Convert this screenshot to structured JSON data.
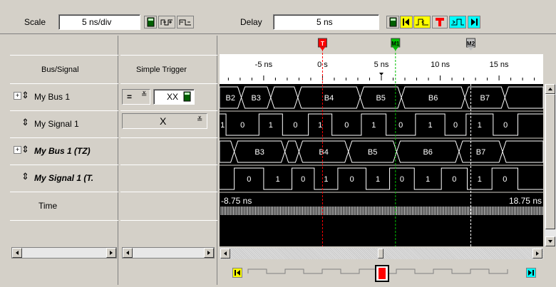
{
  "toolbar": {
    "scale_label": "Scale",
    "scale_value": "5 ns/div",
    "delay_label": "Delay",
    "delay_value": "5 ns"
  },
  "columns": {
    "bus_signal_header": "Bus/Signal",
    "trigger_header": "Simple Trigger"
  },
  "rows": [
    {
      "name": "My Bus 1",
      "type": "bus",
      "trigger_op": "=",
      "trigger_value": "XX"
    },
    {
      "name": "My Signal 1",
      "type": "signal",
      "trigger_value": "X"
    },
    {
      "name": "My Bus 1 (TZ)",
      "type": "bus"
    },
    {
      "name": "My Signal 1 (T.",
      "type": "signal"
    },
    {
      "name": "Time",
      "type": "time"
    }
  ],
  "markers": {
    "trigger": "T",
    "m1": "M1",
    "m2": "M2"
  },
  "ruler": {
    "ticks": [
      {
        "t": -5,
        "label": "-5 ns"
      },
      {
        "t": 0,
        "label": "0 s"
      },
      {
        "t": 5,
        "label": "5 ns"
      },
      {
        "t": 10,
        "label": "10 ns"
      },
      {
        "t": 15,
        "label": "15 ns"
      }
    ]
  },
  "time_row": {
    "start": "-8.75 ns",
    "end": "18.75 ns"
  },
  "waveform": {
    "t_start": -8.75,
    "t_end": 18.75,
    "trigger_time": 0,
    "m1_time": 6.2,
    "m2_time": 12.6,
    "bus1": {
      "segments": [
        {
          "t0": -8.75,
          "t1": -6.9,
          "label": "B2"
        },
        {
          "t0": -6.9,
          "t1": -4.4,
          "label": "B3"
        },
        {
          "t0": -4.4,
          "t1": -2.1,
          "label": ""
        },
        {
          "t0": -2.1,
          "t1": 3.2,
          "label": "B4"
        },
        {
          "t0": 3.2,
          "t1": 6.7,
          "label": "B5"
        },
        {
          "t0": 6.7,
          "t1": 12.1,
          "label": "B6"
        },
        {
          "t0": 12.1,
          "t1": 15.5,
          "label": "B7"
        },
        {
          "t0": 15.5,
          "t1": 18.75,
          "label": ""
        }
      ]
    },
    "signal1": {
      "initial": 1,
      "edges": [
        -8.2,
        -5.4,
        -3.4,
        -1.2,
        0.8,
        3.3,
        5.4,
        7.9,
        10.4,
        12.2,
        14.5,
        16.6
      ],
      "labels": [
        {
          "t": -8.5,
          "label": "1"
        },
        {
          "t": -6.8,
          "label": "0"
        },
        {
          "t": -4.4,
          "label": "1"
        },
        {
          "t": -2.3,
          "label": "0"
        },
        {
          "t": -0.2,
          "label": "1"
        },
        {
          "t": 2.05,
          "label": "0"
        },
        {
          "t": 4.35,
          "label": "1"
        },
        {
          "t": 6.65,
          "label": "0"
        },
        {
          "t": 9.15,
          "label": "1"
        },
        {
          "t": 11.3,
          "label": "0"
        },
        {
          "t": 13.35,
          "label": "1"
        },
        {
          "t": 15.55,
          "label": "0"
        }
      ]
    },
    "bus_tz": {
      "segments": [
        {
          "t0": -8.75,
          "t1": -7.5,
          "label": ""
        },
        {
          "t0": -7.5,
          "t1": -3.2,
          "label": "B3"
        },
        {
          "t0": -3.2,
          "t1": -2.0,
          "label": ""
        },
        {
          "t0": -2.0,
          "t1": 2.2,
          "label": "B4"
        },
        {
          "t0": 2.2,
          "t1": 6.3,
          "label": "B5"
        },
        {
          "t0": 6.3,
          "t1": 11.6,
          "label": "B6"
        },
        {
          "t0": 11.6,
          "t1": 15.3,
          "label": "B7"
        },
        {
          "t0": 15.3,
          "t1": 18.75,
          "label": ""
        }
      ]
    },
    "signal_tz": {
      "initial": 0,
      "edges": [
        -7.5,
        -5.0,
        -2.6,
        -0.7,
        1.3,
        3.7,
        5.7,
        7.8,
        10.1,
        12.3,
        14.4,
        16.6
      ],
      "labels": [
        {
          "t": -6.25,
          "label": "0"
        },
        {
          "t": -3.8,
          "label": "1"
        },
        {
          "t": -1.65,
          "label": "0"
        },
        {
          "t": 0.3,
          "label": "1"
        },
        {
          "t": 2.5,
          "label": "0"
        },
        {
          "t": 4.7,
          "label": "1"
        },
        {
          "t": 6.75,
          "label": "0"
        },
        {
          "t": 8.95,
          "label": "1"
        },
        {
          "t": 11.2,
          "label": "0"
        },
        {
          "t": 13.35,
          "label": "1"
        },
        {
          "t": 15.5,
          "label": "0"
        }
      ]
    }
  },
  "colors": {
    "trigger": "#ff0000",
    "m1": "#00c000",
    "m2": "#ffffff",
    "wave_bg": "#000000",
    "wave_fg": "#ffffff",
    "go_start": "#ffff00",
    "go_end": "#00ffff"
  }
}
